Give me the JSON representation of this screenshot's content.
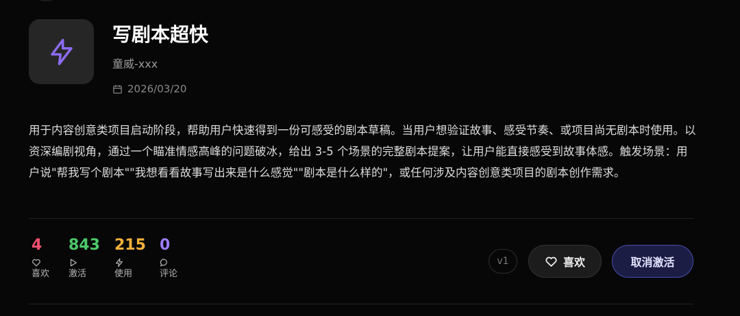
{
  "skill": {
    "title": "写剧本超快",
    "author": "童威-xxx",
    "date": "2026/03/20",
    "description": "用于内容创意类项目启动阶段，帮助用户快速得到一份可感受的剧本草稿。当用户想验证故事、感受节奏、或项目尚无剧本时使用。以资深编剧视角，通过一个瞄准情感高峰的问题破冰，给出 3-5 个场景的完整剧本提案，让用户能直接感受到故事体感。触发场景：用户说\"帮我写个剧本\"\"我想看看故事写出来是什么感觉\"\"剧本是什么样的\"，或任何涉及内容创意类项目的剧本创作需求。",
    "icon": "lightning-bolt-icon"
  },
  "stats": [
    {
      "value": "4",
      "label": "喜欢",
      "icon": "heart-icon",
      "color": "#f0506e"
    },
    {
      "value": "843",
      "label": "激活",
      "icon": "play-icon",
      "color": "#4cc96a"
    },
    {
      "value": "215",
      "label": "使用",
      "icon": "bolt-icon",
      "color": "#f3b23a"
    },
    {
      "value": "0",
      "label": "评论",
      "icon": "comment-icon",
      "color": "#9b7cf5"
    }
  ],
  "actions": {
    "version": "v1",
    "like_label": "喜欢",
    "deactivate_label": "取消激活"
  },
  "colors": {
    "accent": "#8b6cf0",
    "background": "#070707"
  }
}
